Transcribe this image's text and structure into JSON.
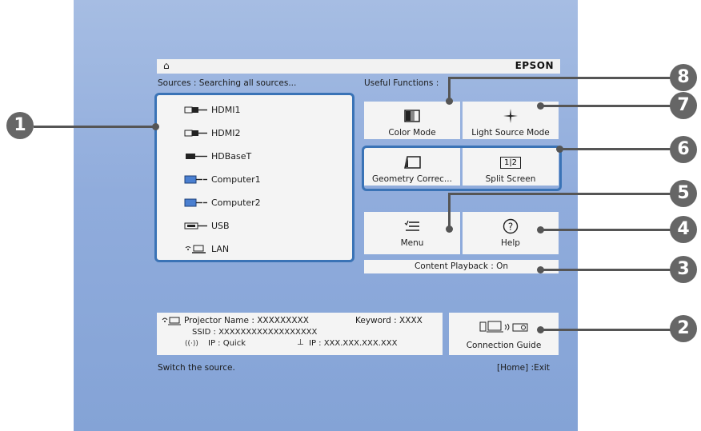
{
  "header": {
    "brand": "EPSON"
  },
  "sources": {
    "title": "Sources : Searching all sources...",
    "items": [
      {
        "label": "HDMI1",
        "icon": "hdmi-icon"
      },
      {
        "label": "HDMI2",
        "icon": "hdmi-icon"
      },
      {
        "label": "HDBaseT",
        "icon": "hdbaset-icon"
      },
      {
        "label": "Computer1",
        "icon": "computer-icon"
      },
      {
        "label": "Computer2",
        "icon": "computer-icon"
      },
      {
        "label": "USB",
        "icon": "usb-icon"
      },
      {
        "label": "LAN",
        "icon": "lan-icon"
      }
    ]
  },
  "functions": {
    "title": "Useful Functions :",
    "color_mode": "Color Mode",
    "light_source_mode": "Light Source Mode",
    "geometry_correction": "Geometry Correc...",
    "split_screen": "Split Screen",
    "split_screen_icon_text": "1|2",
    "menu": "Menu",
    "help": "Help",
    "content_playback": "Content Playback : On"
  },
  "network": {
    "projector_name": "Projector Name : XXXXXXXXX",
    "keyword": "Keyword : XXXX",
    "ssid": "SSID : XXXXXXXXXXXXXXXXXX",
    "ip_quick": "IP : Quick",
    "ip_wired": "IP : XXX.XXX.XXX.XXX",
    "connection_guide": "Connection Guide"
  },
  "footer": {
    "hint": "Switch the source.",
    "exit": "[Home] :Exit"
  },
  "callouts": [
    "1",
    "2",
    "3",
    "4",
    "5",
    "6",
    "7",
    "8"
  ],
  "colors": {
    "highlight": "#3a73b6",
    "callout": "#666666",
    "screen": "#90acdc"
  }
}
